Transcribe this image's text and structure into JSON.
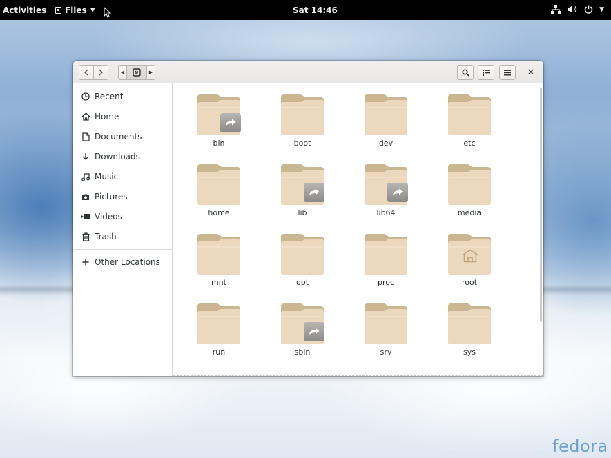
{
  "topbar": {
    "activities": "Activities",
    "app_menu": "Files",
    "clock": "Sat 14:46"
  },
  "window": {
    "sidebar": {
      "items": [
        {
          "label": "Recent",
          "icon": "clock-icon"
        },
        {
          "label": "Home",
          "icon": "home-icon"
        },
        {
          "label": "Documents",
          "icon": "document-icon"
        },
        {
          "label": "Downloads",
          "icon": "download-icon"
        },
        {
          "label": "Music",
          "icon": "music-icon"
        },
        {
          "label": "Pictures",
          "icon": "camera-icon"
        },
        {
          "label": "Videos",
          "icon": "video-icon"
        },
        {
          "label": "Trash",
          "icon": "trash-icon"
        }
      ],
      "other_locations": "Other Locations"
    },
    "folders": [
      {
        "name": "bin",
        "emblem": "symlink"
      },
      {
        "name": "boot",
        "emblem": ""
      },
      {
        "name": "dev",
        "emblem": ""
      },
      {
        "name": "etc",
        "emblem": ""
      },
      {
        "name": "home",
        "emblem": ""
      },
      {
        "name": "lib",
        "emblem": "symlink"
      },
      {
        "name": "lib64",
        "emblem": "symlink"
      },
      {
        "name": "media",
        "emblem": ""
      },
      {
        "name": "mnt",
        "emblem": ""
      },
      {
        "name": "opt",
        "emblem": ""
      },
      {
        "name": "proc",
        "emblem": ""
      },
      {
        "name": "root",
        "emblem": "home"
      },
      {
        "name": "run",
        "emblem": ""
      },
      {
        "name": "sbin",
        "emblem": "symlink"
      },
      {
        "name": "srv",
        "emblem": ""
      },
      {
        "name": "sys",
        "emblem": ""
      }
    ]
  },
  "desktop": {
    "logo_text": "fedora"
  },
  "colors": {
    "folder_body": "#ecd9bd",
    "folder_tab": "#cbb692",
    "accent_logo": "#6e9fd0"
  }
}
